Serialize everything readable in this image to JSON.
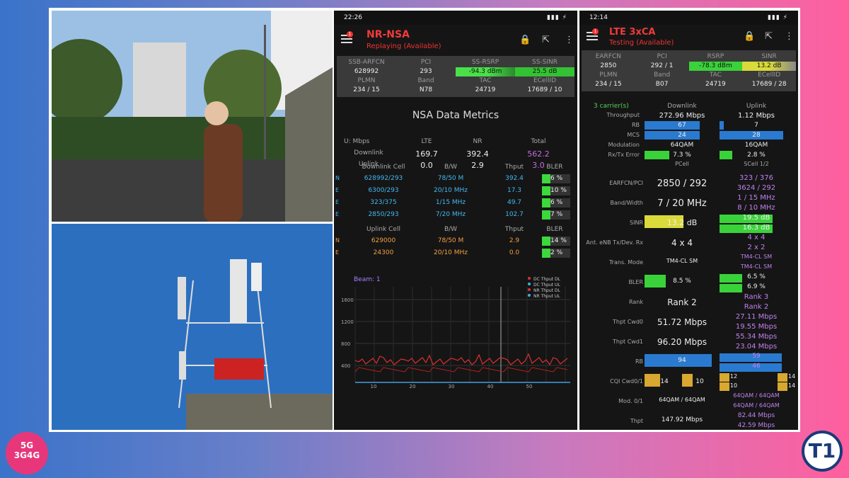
{
  "left_panel": {
    "status_time": "22:26",
    "status_icons": "▮▮▮ ⚡",
    "title": "NR-NSA",
    "subtitle": "Replaying (Available)",
    "badge": "1",
    "info_headers": [
      "SSB-ARFCN",
      "PCI",
      "SS-RSRP",
      "SS-SINR"
    ],
    "info_values": [
      "628992",
      "293",
      "-94.3 dBm",
      "25.5 dB"
    ],
    "info_headers2": [
      "PLMN",
      "Band",
      "TAC",
      "ECellID"
    ],
    "info_values2": [
      "234 / 15",
      "N78",
      "24719",
      "17689 / 10"
    ],
    "metrics_title": "NSA Data Metrics",
    "metrics_head": [
      "U: Mbps",
      "LTE",
      "NR",
      "Total"
    ],
    "downlink": [
      "Downlink",
      "169.7",
      "392.4",
      "562.2"
    ],
    "uplink": [
      "Uplink",
      "0.0",
      "2.9",
      "3.0"
    ],
    "dl_head": [
      "Downlink Cell",
      "B/W",
      "Thput",
      "BLER"
    ],
    "dl_rows": [
      {
        "t": "N",
        "cell": "628992/293",
        "bw": "78/50 M",
        "thput": "392.4",
        "bler": "6 %"
      },
      {
        "t": "E",
        "cell": "6300/293",
        "bw": "20/10 MHz",
        "thput": "17.3",
        "bler": "10 %"
      },
      {
        "t": "E",
        "cell": "323/375",
        "bw": "1/15 MHz",
        "thput": "49.7",
        "bler": "6 %"
      },
      {
        "t": "E",
        "cell": "2850/293",
        "bw": "7/20 MHz",
        "thput": "102.7",
        "bler": "7 %"
      }
    ],
    "ul_head": [
      "Uplink Cell",
      "B/W",
      "Thput",
      "BLER"
    ],
    "ul_rows": [
      {
        "t": "N",
        "cell": "629000",
        "bw": "78/50 M",
        "thput": "2.9",
        "bler": "14 %"
      },
      {
        "t": "E",
        "cell": "24300",
        "bw": "20/10 MHz",
        "thput": "0.0",
        "bler": "2 %"
      }
    ],
    "graph_label": "Beam: 1",
    "legend": [
      "DC Thput DL",
      "DC Thput UL",
      "NR Thput DL",
      "NR Thput UL"
    ],
    "y_ticks": [
      "1600",
      "1200",
      "800",
      "400"
    ],
    "x_ticks": [
      "10",
      "20",
      "30",
      "40",
      "50"
    ]
  },
  "right_panel": {
    "status_time": "12:14",
    "title": "LTE 3xCA",
    "subtitle": "Testing (Available)",
    "badge": "1",
    "info_headers": [
      "EARFCN",
      "PCI",
      "RSRP",
      "SINR"
    ],
    "info_values": [
      "2850",
      "292 / 1",
      "-78.3 dBm",
      "13.2 dB"
    ],
    "info_headers2": [
      "PLMN",
      "Band",
      "TAC",
      "ECellID"
    ],
    "info_values2": [
      "234 / 15",
      "B07",
      "24719",
      "17689 / 28"
    ],
    "carriers": "3 carrier(s)",
    "col_dl": "Downlink",
    "col_ul": "Uplink",
    "rows": [
      {
        "l": "Throughput",
        "dl": "272.96 Mbps",
        "ul": "1.12 Mbps"
      },
      {
        "l": "RB",
        "dl": "67",
        "ul": "7"
      },
      {
        "l": "MCS",
        "dl": "24",
        "ul": "28"
      },
      {
        "l": "Modulation",
        "dl": "64QAM",
        "ul": "16QAM"
      },
      {
        "l": "Rx/Tx Error",
        "dl": "7.3 %",
        "ul": "2.8 %"
      }
    ],
    "pcell": "PCell",
    "scell": "SCell 1/2",
    "earfcn_label": "EARFCN/PCI",
    "earfcn_p": "2850 / 292",
    "earfcn_s": [
      "323 / 376",
      "3624 / 292"
    ],
    "bw_label": "Band/Width",
    "bw_p": "7 / 20 MHz",
    "bw_s": [
      "1 / 15 MHz",
      "8 / 10 MHz"
    ],
    "sinr_label": "SINR",
    "sinr_p": "13.2 dB",
    "sinr_s": [
      "19.5 dB",
      "16.3 dB"
    ],
    "ant_label": "Ant. eNB Tx/Dev. Rx",
    "ant_p": "4 x 4",
    "ant_s": [
      "4 x 4",
      "2 x 2"
    ],
    "tm_label": "Trans. Mode",
    "tm_p": "TM4-CL SM",
    "tm_s": [
      "TM4-CL SM",
      "TM4-CL SM"
    ],
    "bler_label": "BLER",
    "bler_p": "8.5 %",
    "bler_s": [
      "6.5 %",
      "6.9 %"
    ],
    "rank_label": "Rank",
    "rank_p": "Rank 2",
    "rank_s": [
      "Rank 3",
      "Rank 2"
    ],
    "cw0_label": "Thpt Cwd0",
    "cw0_p": "51.72 Mbps",
    "cw0_s": [
      "27.11 Mbps",
      "19.55 Mbps"
    ],
    "cw1_label": "Thpt Cwd1",
    "cw1_p": "96.20 Mbps",
    "cw1_s": [
      "55.34 Mbps",
      "23.04 Mbps"
    ],
    "rb_label": "RB",
    "rb_p": "94",
    "rb_s": [
      "59",
      "46"
    ],
    "cqi_label": "CQI Cwd0/1",
    "cqi_p": [
      "14",
      "10"
    ],
    "cqi_s": [
      "12",
      "14",
      "10",
      "14"
    ],
    "mod_label": "Mod. 0/1",
    "mod_p": "64QAM / 64QAM",
    "mod_s": [
      "64QAM / 64QAM",
      "64QAM / 64QAM"
    ],
    "thpt_label": "Thpt",
    "thpt_p": "147.92 Mbps",
    "thpt_s": [
      "82.44 Mbps",
      "42.59 Mbps"
    ]
  },
  "logo_left": [
    "5G",
    "3G4G"
  ],
  "logo_right": "T1"
}
